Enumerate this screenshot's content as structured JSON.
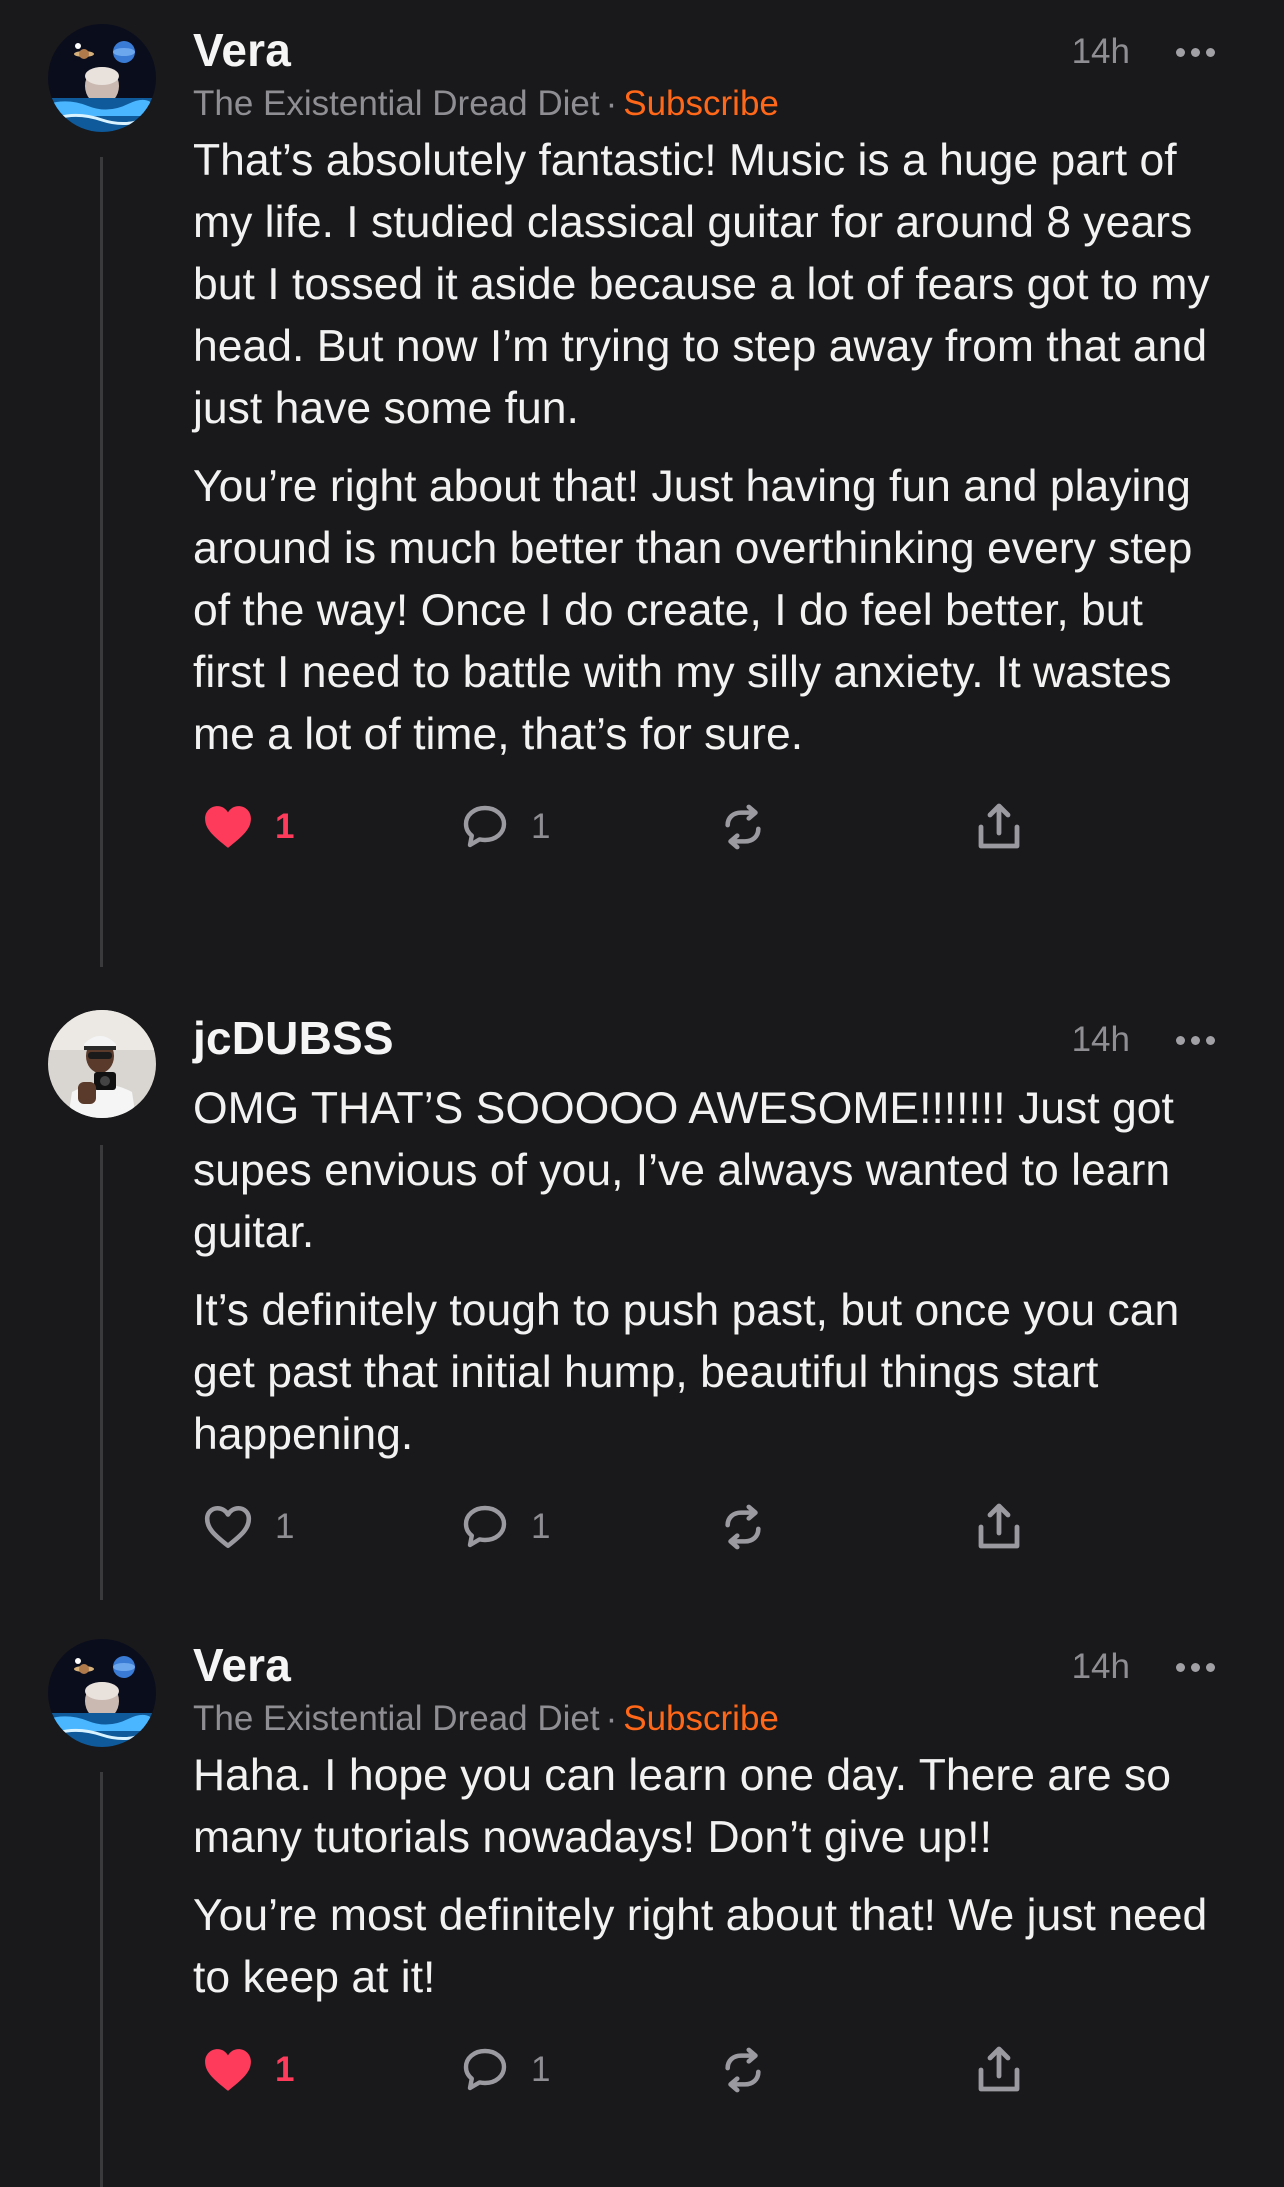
{
  "comments": [
    {
      "author": "Vera",
      "time": "14h",
      "publication": "The Existential Dread Diet",
      "separator": "·",
      "subscribe_label": "Subscribe",
      "paragraphs": [
        "That’s absolutely fantastic! Music is a huge part of my life. I studied classical guitar for around 8 years but I tossed it aside because a lot of fears got to my head. But now I’m trying to step away from that and just have some fun.",
        "You’re right about that! Just having fun and playing around is much better than overthinking every step of the way! Once I do create, I do feel better, but first I need to battle with my silly anxiety. It wastes me a lot of time, that’s for sure."
      ],
      "likes": "1",
      "liked": true,
      "replies": "1"
    },
    {
      "author": "jcDUBSS",
      "time": "14h",
      "paragraphs": [
        "OMG THAT’S SOOOOO AWESOME!!!!!!! Just got supes envious of you, I’ve always wanted to learn guitar.",
        "It’s definitely tough to push past, but once you can get past that initial hump, beautiful things start happening."
      ],
      "likes": "1",
      "liked": false,
      "replies": "1"
    },
    {
      "author": "Vera",
      "time": "14h",
      "publication": "The Existential Dread Diet",
      "separator": "·",
      "subscribe_label": "Subscribe",
      "paragraphs": [
        "Haha. I hope you can learn one day. There are so many tutorials nowadays! Don’t give up!!",
        "You’re most definitely right about that! We just need to keep at it!"
      ],
      "likes": "1",
      "liked": true,
      "replies": "1"
    }
  ],
  "icons": {
    "like": "heart-icon",
    "reply": "comment-bubble-icon",
    "restack": "restack-icon",
    "share": "share-icon",
    "more": "more-dots-icon"
  },
  "colors": {
    "background": "#19191b",
    "accent_subscribe": "#ff6719",
    "liked": "#ff3b5c",
    "muted": "#8e8e93"
  }
}
